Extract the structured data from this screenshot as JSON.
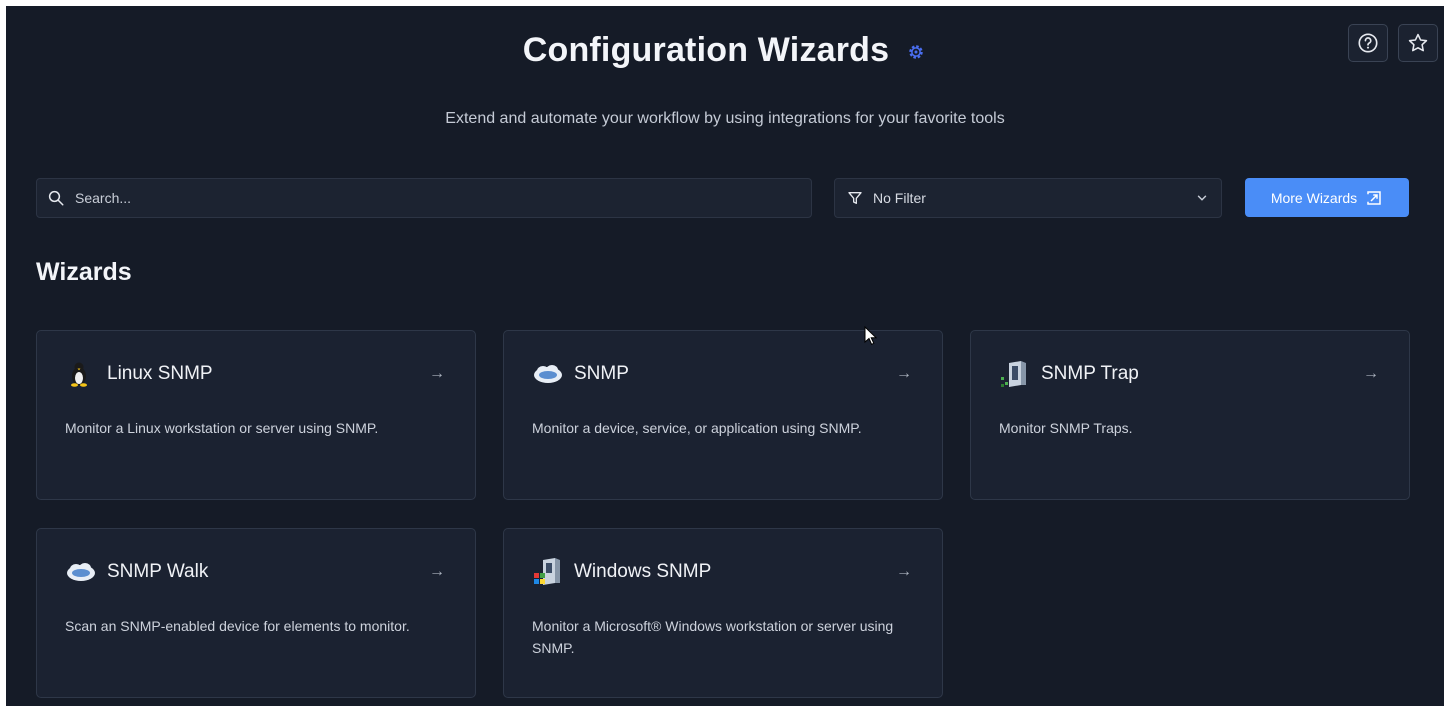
{
  "header": {
    "title": "Configuration Wizards",
    "subtitle": "Extend and automate your workflow by using integrations for your favorite tools",
    "icons": [
      "gear-icon",
      "help-icon",
      "star-icon"
    ]
  },
  "toolbar": {
    "search_placeholder": "Search...",
    "filter_value": "No Filter",
    "more_button_label": "More Wizards"
  },
  "section": {
    "title": "Wizards"
  },
  "wizards": [
    {
      "name": "Linux SNMP",
      "description": "Monitor a Linux workstation or server using SNMP.",
      "icon": "linux-penguin-icon"
    },
    {
      "name": "SNMP",
      "description": "Monitor a device, service, or application using SNMP.",
      "icon": "snmp-cloud-icon"
    },
    {
      "name": "SNMP Trap",
      "description": "Monitor SNMP Traps.",
      "icon": "server-trap-icon"
    },
    {
      "name": "SNMP Walk",
      "description": "Scan an SNMP-enabled device for elements to monitor.",
      "icon": "snmp-cloud-icon"
    },
    {
      "name": "Windows SNMP",
      "description": "Monitor a Microsoft® Windows workstation or server using SNMP.",
      "icon": "windows-server-icon"
    }
  ],
  "colors": {
    "background": "#151b27",
    "card": "#1b2231",
    "accent": "#4a8df7"
  }
}
